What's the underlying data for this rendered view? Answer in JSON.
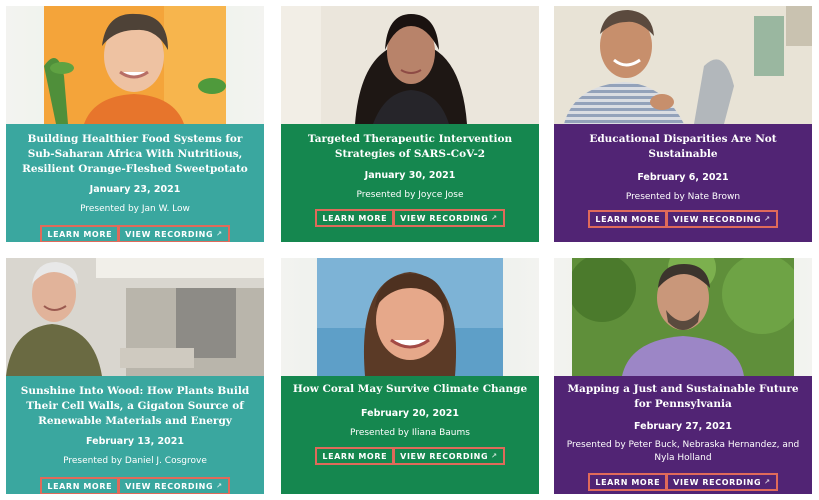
{
  "cards": [
    {
      "title": "Building Healthier Food Systems for Sub-Saharan Africa With Nutritious, Resilient Orange-Fleshed Sweetpotato",
      "date": "January 23, 2021",
      "presenter": "Presented by Jan W. Low",
      "learn_more": "LEARN MORE",
      "view_recording": "VIEW RECORDING",
      "color": "#3aa79f"
    },
    {
      "title": "Targeted Therapeutic Intervention Strategies of SARS-CoV-2",
      "date": "January 30, 2021",
      "presenter": "Presented by Joyce Jose",
      "learn_more": "LEARN MORE",
      "view_recording": "VIEW RECORDING",
      "color": "#15874f"
    },
    {
      "title": "Educational Disparities Are Not Sustainable",
      "date": "February 6, 2021",
      "presenter": "Presented by Nate Brown",
      "learn_more": "LEARN MORE",
      "view_recording": "VIEW RECORDING",
      "color": "#512474"
    },
    {
      "title": "Sunshine Into Wood: How Plants Build Their Cell Walls, a Gigaton Source of Renewable Materials and Energy",
      "date": "February 13, 2021",
      "presenter": "Presented by Daniel J. Cosgrove",
      "learn_more": "LEARN MORE",
      "view_recording": "VIEW RECORDING",
      "color": "#3aa79f"
    },
    {
      "title": "How Coral May Survive Climate Change",
      "date": "February 20, 2021",
      "presenter": "Presented by Iliana Baums",
      "learn_more": "LEARN MORE",
      "view_recording": "VIEW RECORDING",
      "color": "#15874f"
    },
    {
      "title": "Mapping a Just and Sustainable Future for Pennsylvania",
      "date": "February 27, 2021",
      "presenter": "Presented by Peter Buck, Nebraska Hernandez, and Nyla Holland",
      "learn_more": "LEARN MORE",
      "view_recording": "VIEW RECORDING",
      "color": "#512474"
    }
  ],
  "colors": {
    "button_border": "#e06a5a",
    "teal": "#3aa79f",
    "green": "#15874f",
    "purple": "#512474"
  },
  "icons": {
    "external_link": "external-link-icon"
  }
}
